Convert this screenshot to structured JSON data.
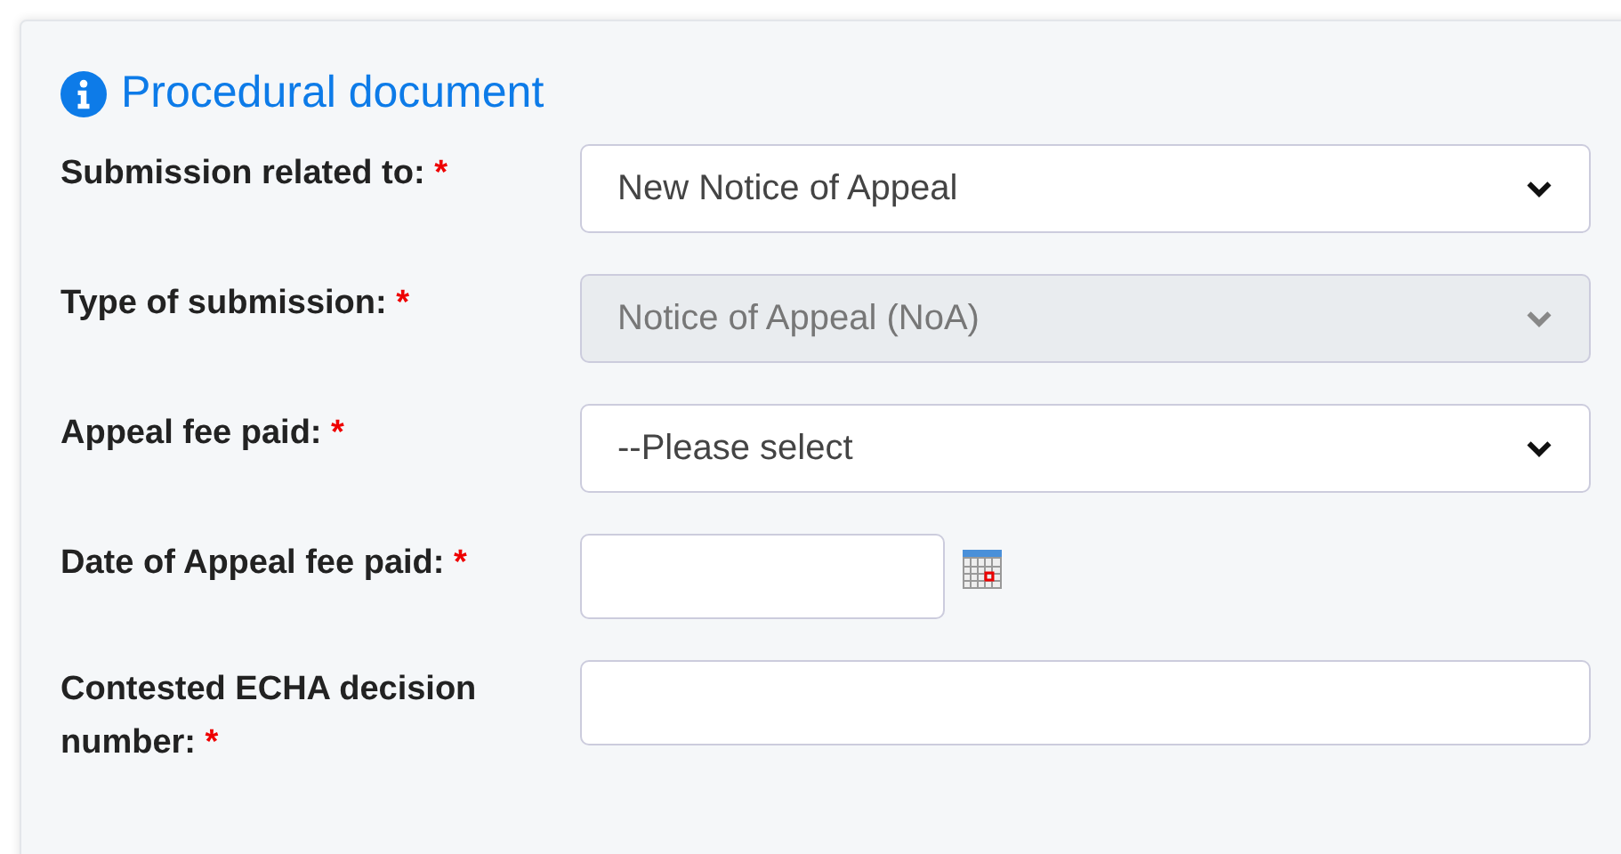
{
  "section": {
    "title": "Procedural document"
  },
  "fields": [
    {
      "kind": "select",
      "label": "Submission related to:",
      "required_mark": "*",
      "value": "New Notice of Appeal",
      "disabled": false
    },
    {
      "kind": "select",
      "label": "Type of submission:",
      "required_mark": "*",
      "value": "Notice of Appeal (NoA)",
      "disabled": true
    },
    {
      "kind": "select",
      "label": "Appeal fee paid:",
      "required_mark": "*",
      "value": "--Please select",
      "disabled": false
    },
    {
      "kind": "date",
      "label": "Date of Appeal fee paid:",
      "required_mark": "*",
      "disabled": false
    },
    {
      "kind": "text",
      "label": "Contested ECHA decision number:",
      "required_mark": "*",
      "disabled": false
    }
  ]
}
